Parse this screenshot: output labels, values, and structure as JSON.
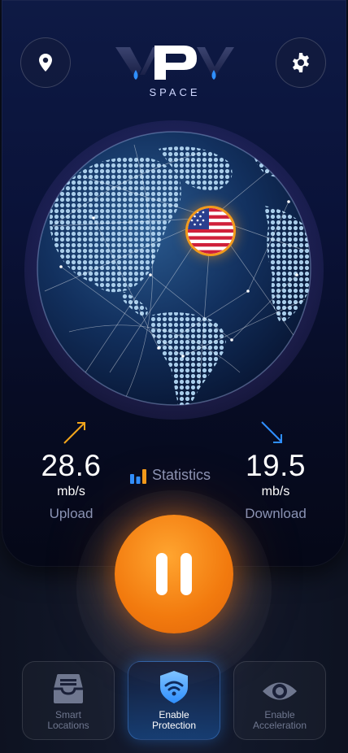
{
  "header": {
    "logo_text": "VPV",
    "logo_subtitle": "SPACE",
    "location_icon": "map-pin-icon",
    "settings_icon": "gear-icon"
  },
  "connection": {
    "country_flag": "us-flag-icon",
    "upload": {
      "value": "28.6",
      "unit": "mb/s",
      "label": "Upload"
    },
    "download": {
      "value": "19.5",
      "unit": "mb/s",
      "label": "Download"
    },
    "statistics_label": "Statistics"
  },
  "power_button": {
    "icon": "pause-icon",
    "state": "connected"
  },
  "bottom_nav": {
    "items": [
      {
        "label_line1": "Smart",
        "label_line2": "Locations",
        "icon": "inbox-tray-icon"
      },
      {
        "label_line1": "Enable",
        "label_line2": "Protection",
        "icon": "shield-wifi-icon"
      },
      {
        "label_line1": "Enable",
        "label_line2": "Acceleration",
        "icon": "eye-icon"
      }
    ]
  },
  "colors": {
    "accent": "#f27a0e",
    "upload_arrow": "#f2a51b",
    "download_arrow": "#2f8fff",
    "panel": "#0a1238",
    "muted_text": "#8a93b5"
  }
}
